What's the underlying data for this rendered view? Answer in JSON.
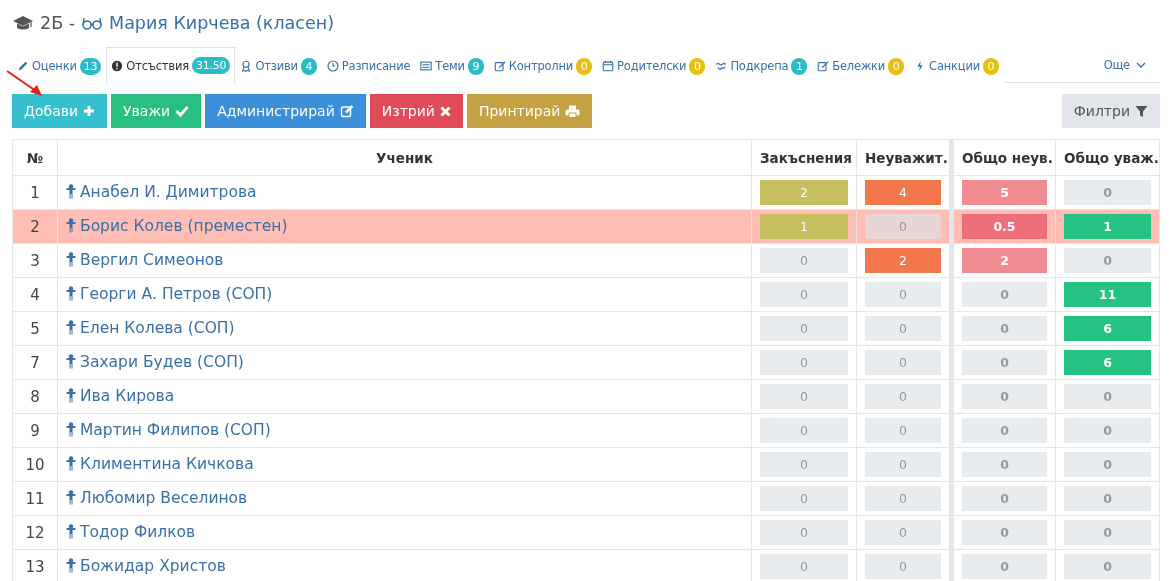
{
  "header": {
    "class_name": "2Б -",
    "teacher": "Мария Кирчева (класен)"
  },
  "tabs": [
    {
      "label": "Оценки",
      "badge": {
        "text": "13",
        "color": "#2bbbc9"
      },
      "selected": false
    },
    {
      "label": "Отсъствия",
      "badge": {
        "text": "31.50",
        "color": "#2bbbc9"
      },
      "selected": true
    },
    {
      "label": "Отзиви",
      "badge": {
        "text": "4",
        "color": "#2bbbc9"
      },
      "selected": false
    },
    {
      "label": "Разписание",
      "selected": false
    },
    {
      "label": "Теми",
      "badge": {
        "text": "9",
        "color": "#2bbbc9"
      },
      "selected": false
    },
    {
      "label": "Контролни",
      "badge": {
        "text": "0",
        "color": "#e8bf0f"
      },
      "selected": false
    },
    {
      "label": "Родителски",
      "badge": {
        "text": "0",
        "color": "#e8bf0f"
      },
      "selected": false
    },
    {
      "label": "Подкрепа",
      "badge": {
        "text": "1",
        "color": "#2bbbc9"
      },
      "selected": false
    },
    {
      "label": "Бележки",
      "badge": {
        "text": "0",
        "color": "#e8bf0f"
      },
      "selected": false
    },
    {
      "label": "Санкции",
      "badge": {
        "text": "0",
        "color": "#e8bf0f"
      },
      "selected": false
    }
  ],
  "more_menu": {
    "label": "Още"
  },
  "buttons": [
    {
      "label": "Добави",
      "color": "#36bfcd"
    },
    {
      "label": "Уважи",
      "color": "#27c07f"
    },
    {
      "label": "Администрирай",
      "color": "#3a8fd8"
    },
    {
      "label": "Изтрий",
      "color": "#e04b5a"
    },
    {
      "label": "Принтирай",
      "color": "#c4a244"
    }
  ],
  "filter_button": {
    "label": "Филтри"
  },
  "table": {
    "columns": [
      "№",
      "Ученик",
      "Закъснения",
      "Неуважит.",
      "Общо неув.",
      "Общо уваж."
    ],
    "rows": [
      {
        "highlighted": false,
        "cells": [
          {
            "kind": "number",
            "text": "1"
          },
          {
            "kind": "student",
            "text": "Анабел И. Димитрова"
          },
          {
            "kind": "count",
            "value": "2",
            "color": "#c5bf5f",
            "muted": false
          },
          {
            "kind": "count",
            "value": "4",
            "color": "#f2784b",
            "muted": false
          },
          {
            "kind": "count",
            "value": "5",
            "color": "#ef8b91",
            "muted": false
          },
          {
            "kind": "count",
            "value": "0",
            "color": "#e9ecef",
            "muted": true
          }
        ]
      },
      {
        "highlighted": true,
        "cells": [
          {
            "kind": "number",
            "text": "2"
          },
          {
            "kind": "student",
            "text": "Борис Колев (преместен)"
          },
          {
            "kind": "count",
            "value": "1",
            "color": "#c5bf5f",
            "muted": false
          },
          {
            "kind": "count",
            "value": "0",
            "color": "#e8d6d6",
            "muted": true
          },
          {
            "kind": "count",
            "value": "0.5",
            "color": "#ec6f7a",
            "muted": false
          },
          {
            "kind": "count",
            "value": "1",
            "color": "#26c281",
            "muted": false
          }
        ]
      },
      {
        "highlighted": false,
        "cells": [
          {
            "kind": "number",
            "text": "3"
          },
          {
            "kind": "student",
            "text": "Вергил Симеонов"
          },
          {
            "kind": "count",
            "value": "0",
            "color": "#e9ecef",
            "muted": true
          },
          {
            "kind": "count",
            "value": "2",
            "color": "#f2784b",
            "muted": false
          },
          {
            "kind": "count",
            "value": "2",
            "color": "#ef8b91",
            "muted": false
          },
          {
            "kind": "count",
            "value": "0",
            "color": "#e9ecef",
            "muted": true
          }
        ]
      },
      {
        "highlighted": false,
        "cells": [
          {
            "kind": "number",
            "text": "4"
          },
          {
            "kind": "student",
            "text": "Георги А. Петров (СОП)"
          },
          {
            "kind": "count",
            "value": "0",
            "color": "#e9ecef",
            "muted": true
          },
          {
            "kind": "count",
            "value": "0",
            "color": "#e9ecef",
            "muted": true
          },
          {
            "kind": "count",
            "value": "0",
            "color": "#e9ecef",
            "muted": true
          },
          {
            "kind": "count",
            "value": "11",
            "color": "#26c281",
            "muted": false
          }
        ]
      },
      {
        "highlighted": false,
        "cells": [
          {
            "kind": "number",
            "text": "5"
          },
          {
            "kind": "student",
            "text": "Елен Колева (СОП)"
          },
          {
            "kind": "count",
            "value": "0",
            "color": "#e9ecef",
            "muted": true
          },
          {
            "kind": "count",
            "value": "0",
            "color": "#e9ecef",
            "muted": true
          },
          {
            "kind": "count",
            "value": "0",
            "color": "#e9ecef",
            "muted": true
          },
          {
            "kind": "count",
            "value": "6",
            "color": "#26c281",
            "muted": false
          }
        ]
      },
      {
        "highlighted": false,
        "cells": [
          {
            "kind": "number",
            "text": "7"
          },
          {
            "kind": "student",
            "text": "Захари Будев (СОП)"
          },
          {
            "kind": "count",
            "value": "0",
            "color": "#e9ecef",
            "muted": true
          },
          {
            "kind": "count",
            "value": "0",
            "color": "#e9ecef",
            "muted": true
          },
          {
            "kind": "count",
            "value": "0",
            "color": "#e9ecef",
            "muted": true
          },
          {
            "kind": "count",
            "value": "6",
            "color": "#26c281",
            "muted": false
          }
        ]
      },
      {
        "highlighted": false,
        "cells": [
          {
            "kind": "number",
            "text": "8"
          },
          {
            "kind": "student",
            "text": "Ива Кирова"
          },
          {
            "kind": "count",
            "value": "0",
            "color": "#e9ecef",
            "muted": true
          },
          {
            "kind": "count",
            "value": "0",
            "color": "#e9ecef",
            "muted": true
          },
          {
            "kind": "count",
            "value": "0",
            "color": "#e9ecef",
            "muted": true
          },
          {
            "kind": "count",
            "value": "0",
            "color": "#e9ecef",
            "muted": true
          }
        ]
      },
      {
        "highlighted": false,
        "cells": [
          {
            "kind": "number",
            "text": "9"
          },
          {
            "kind": "student",
            "text": "Мартин Филипов (СОП)"
          },
          {
            "kind": "count",
            "value": "0",
            "color": "#e9ecef",
            "muted": true
          },
          {
            "kind": "count",
            "value": "0",
            "color": "#e9ecef",
            "muted": true
          },
          {
            "kind": "count",
            "value": "0",
            "color": "#e9ecef",
            "muted": true
          },
          {
            "kind": "count",
            "value": "0",
            "color": "#e9ecef",
            "muted": true
          }
        ]
      },
      {
        "highlighted": false,
        "cells": [
          {
            "kind": "number",
            "text": "10"
          },
          {
            "kind": "student",
            "text": "Климентина Кичкова"
          },
          {
            "kind": "count",
            "value": "0",
            "color": "#e9ecef",
            "muted": true
          },
          {
            "kind": "count",
            "value": "0",
            "color": "#e9ecef",
            "muted": true
          },
          {
            "kind": "count",
            "value": "0",
            "color": "#e9ecef",
            "muted": true
          },
          {
            "kind": "count",
            "value": "0",
            "color": "#e9ecef",
            "muted": true
          }
        ]
      },
      {
        "highlighted": false,
        "cells": [
          {
            "kind": "number",
            "text": "11"
          },
          {
            "kind": "student",
            "text": "Любомир Веселинов"
          },
          {
            "kind": "count",
            "value": "0",
            "color": "#e9ecef",
            "muted": true
          },
          {
            "kind": "count",
            "value": "0",
            "color": "#e9ecef",
            "muted": true
          },
          {
            "kind": "count",
            "value": "0",
            "color": "#e9ecef",
            "muted": true
          },
          {
            "kind": "count",
            "value": "0",
            "color": "#e9ecef",
            "muted": true
          }
        ]
      },
      {
        "highlighted": false,
        "cells": [
          {
            "kind": "number",
            "text": "12"
          },
          {
            "kind": "student",
            "text": "Тодор Филков"
          },
          {
            "kind": "count",
            "value": "0",
            "color": "#e9ecef",
            "muted": true
          },
          {
            "kind": "count",
            "value": "0",
            "color": "#e9ecef",
            "muted": true
          },
          {
            "kind": "count",
            "value": "0",
            "color": "#e9ecef",
            "muted": true
          },
          {
            "kind": "count",
            "value": "0",
            "color": "#e9ecef",
            "muted": true
          }
        ]
      },
      {
        "highlighted": false,
        "cells": [
          {
            "kind": "number",
            "text": "13"
          },
          {
            "kind": "student",
            "text": "Божидар Христов"
          },
          {
            "kind": "count",
            "value": "0",
            "color": "#e9ecef",
            "muted": true
          },
          {
            "kind": "count",
            "value": "0",
            "color": "#e9ecef",
            "muted": true
          },
          {
            "kind": "count",
            "value": "0",
            "color": "#e9ecef",
            "muted": true
          },
          {
            "kind": "count",
            "value": "0",
            "color": "#e9ecef",
            "muted": true
          }
        ]
      }
    ]
  }
}
